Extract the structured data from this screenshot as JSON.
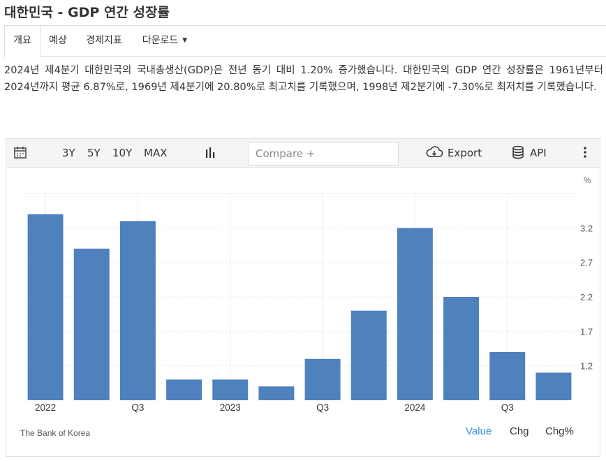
{
  "page": {
    "title": "대한민국 - GDP 연간 성장률"
  },
  "tabs": [
    {
      "label": "개요",
      "active": true
    },
    {
      "label": "예상",
      "active": false
    },
    {
      "label": "경제지표",
      "active": false
    },
    {
      "label": "다운로드",
      "active": false,
      "has_dropdown": true
    }
  ],
  "summary": "2024년 제4분기 대한민국의 국내총생산(GDP)은 전년 동기 대비 1.20% 증가했습니다. 대한민국의 GDP 연간 성장률은 1961년부터 2024년까지 평균 6.87%로, 1969년 제4분기에 20.80%로 최고치를 기록했으며, 1998년 제2분기에 -7.30%로 최저치를 기록했습니다.",
  "toolbar": {
    "calendar_icon": "calendar-icon",
    "ranges": [
      "3Y",
      "5Y",
      "10Y",
      "MAX"
    ],
    "chart_type_icon": "bar-chart-icon",
    "compare_placeholder": "Compare +",
    "export_label": "Export",
    "export_icon": "cloud-download-icon",
    "api_label": "API",
    "api_icon": "database-icon",
    "more_icon": "vertical-dots-icon"
  },
  "chart_data": {
    "type": "bar",
    "unit": "%",
    "categories": [
      "2022 Q1",
      "2022 Q2",
      "2022 Q3",
      "2022 Q4",
      "2023 Q1",
      "2023 Q2",
      "2023 Q3",
      "2023 Q4",
      "2024 Q1",
      "2024 Q2",
      "2024 Q3",
      "2024 Q4"
    ],
    "x_tick_labels": [
      "2022",
      "",
      "Q3",
      "",
      "2023",
      "",
      "Q3",
      "",
      "2024",
      "",
      "Q3",
      ""
    ],
    "values": [
      3.4,
      2.9,
      3.3,
      1.0,
      1.0,
      0.9,
      1.3,
      2.0,
      3.2,
      2.2,
      1.4,
      1.1
    ],
    "y_ticks": [
      1.2,
      1.7,
      2.2,
      2.7,
      3.2
    ],
    "ylim": [
      0.7,
      3.7
    ],
    "bar_color": "#4f81bd",
    "grid": true,
    "y_axis_position": "right"
  },
  "footer": {
    "source": "The Bank of Korea",
    "buttons": [
      {
        "label": "Value",
        "active": true
      },
      {
        "label": "Chg",
        "active": false
      },
      {
        "label": "Chg%",
        "active": false
      }
    ],
    "active_color": "#2e8fe0"
  }
}
